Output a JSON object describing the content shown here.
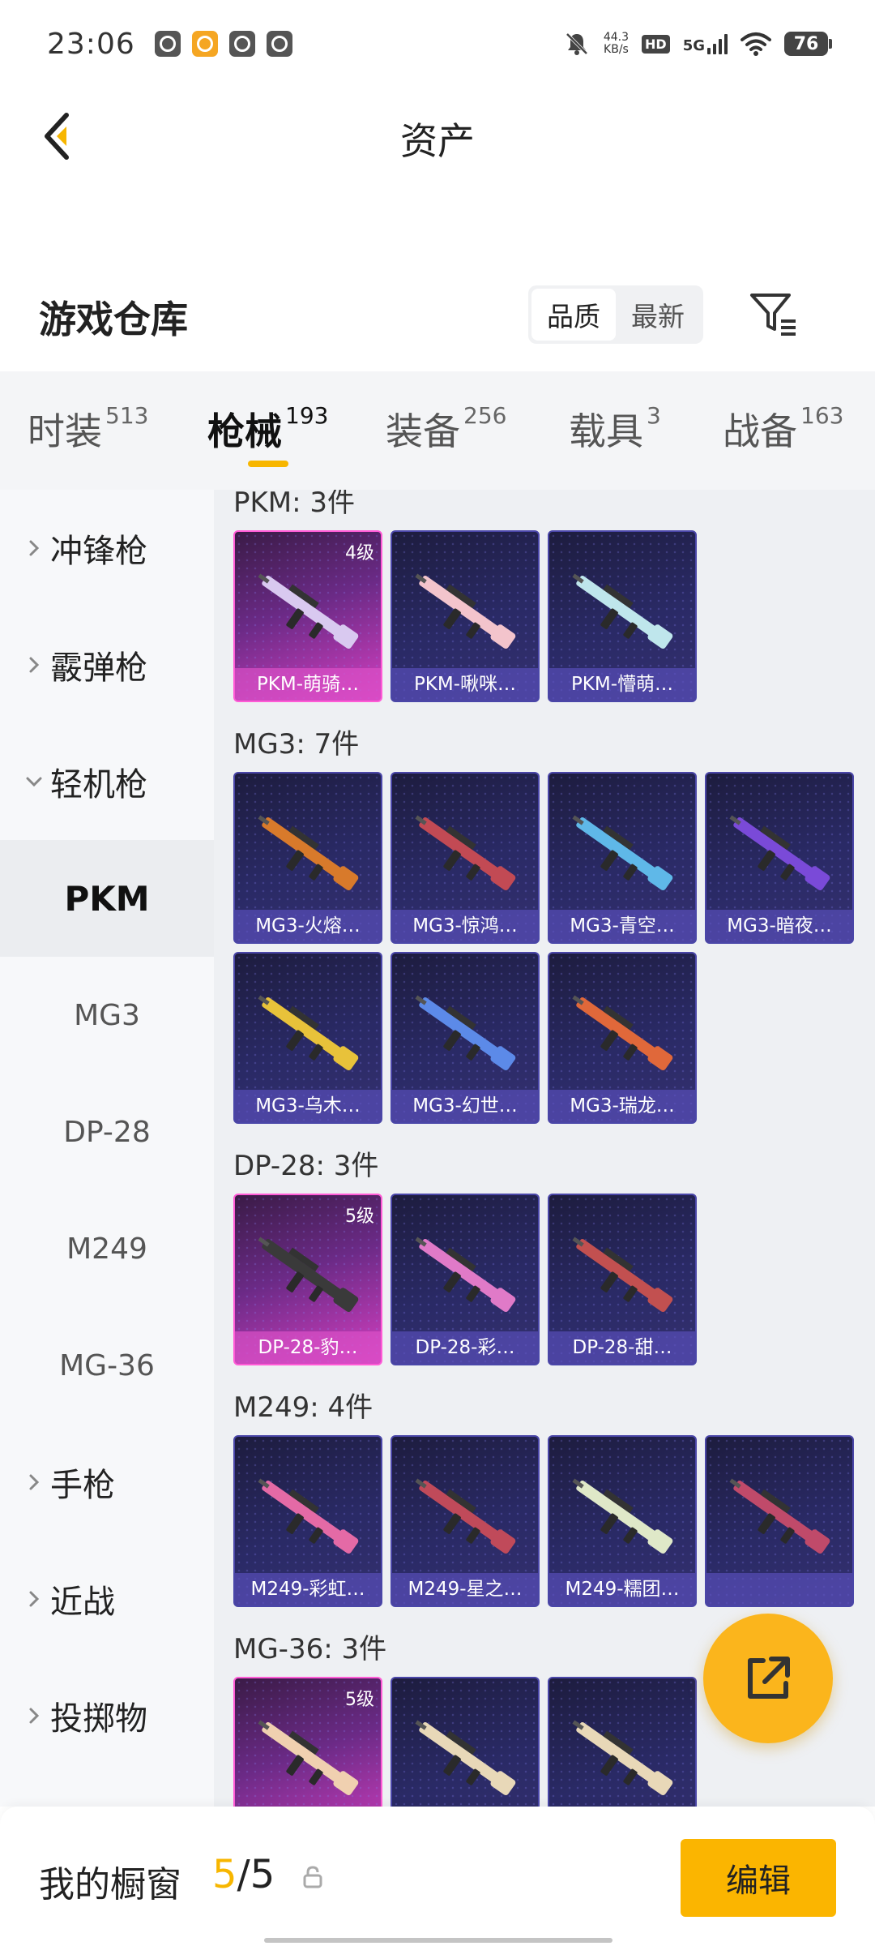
{
  "status_bar": {
    "time": "23:06",
    "net_speed_value": "44.3",
    "net_speed_unit": "KB/s",
    "hd_label": "HD",
    "network_label": "5G",
    "battery_level": "76"
  },
  "header": {
    "title": "资产"
  },
  "warehouse": {
    "title": "游戏仓库",
    "sort_options": [
      "品质",
      "最新"
    ],
    "sort_active": "品质"
  },
  "tabs": [
    {
      "label": "时装",
      "count": "513"
    },
    {
      "label": "枪械",
      "count": "193",
      "active": true
    },
    {
      "label": "装备",
      "count": "256"
    },
    {
      "label": "载具",
      "count": "3"
    },
    {
      "label": "战备",
      "count": "163"
    }
  ],
  "sidebar": {
    "categories": [
      {
        "label": "冲锋枪",
        "expanded": false
      },
      {
        "label": "霰弹枪",
        "expanded": false
      },
      {
        "label": "轻机枪",
        "expanded": true
      },
      {
        "label": "手枪",
        "expanded": false
      },
      {
        "label": "近战",
        "expanded": false
      },
      {
        "label": "投掷物",
        "expanded": false
      }
    ],
    "subitems": [
      {
        "label": "PKM",
        "active": true
      },
      {
        "label": "MG3"
      },
      {
        "label": "DP-28"
      },
      {
        "label": "M249"
      },
      {
        "label": "MG-36"
      }
    ]
  },
  "groups": [
    {
      "title": "PKM: 3件",
      "items": [
        {
          "name": "PKM-萌骑…",
          "level": "4级",
          "rarity": "gold",
          "color": "#d9c9f0"
        },
        {
          "name": "PKM-啾咪…",
          "level": "",
          "rarity": "purple",
          "color": "#f3c4cc"
        },
        {
          "name": "PKM-懵萌…",
          "level": "",
          "rarity": "purple",
          "color": "#bfe6ec"
        }
      ]
    },
    {
      "title": "MG3: 7件",
      "items": [
        {
          "name": "MG3-火熔…",
          "level": "",
          "rarity": "purple",
          "color": "#d87a2b"
        },
        {
          "name": "MG3-惊鸿…",
          "level": "",
          "rarity": "purple",
          "color": "#c24a54"
        },
        {
          "name": "MG3-青空…",
          "level": "",
          "rarity": "purple",
          "color": "#5fb8e8"
        },
        {
          "name": "MG3-暗夜…",
          "level": "",
          "rarity": "purple",
          "color": "#7a4ad8"
        },
        {
          "name": "MG3-乌木…",
          "level": "",
          "rarity": "purple",
          "color": "#e8c23a"
        },
        {
          "name": "MG3-幻世…",
          "level": "",
          "rarity": "purple",
          "color": "#5c8ae8"
        },
        {
          "name": "MG3-瑞龙…",
          "level": "",
          "rarity": "purple",
          "color": "#e0683a"
        }
      ]
    },
    {
      "title": "DP-28: 3件",
      "items": [
        {
          "name": "DP-28-豹…",
          "level": "5级",
          "rarity": "gold",
          "color": "#3a3a3a"
        },
        {
          "name": "DP-28-彩…",
          "level": "",
          "rarity": "purple",
          "color": "#e07ac8"
        },
        {
          "name": "DP-28-甜…",
          "level": "",
          "rarity": "purple",
          "color": "#c25050"
        }
      ]
    },
    {
      "title": "M249: 4件",
      "items": [
        {
          "name": "M249-彩虹…",
          "level": "",
          "rarity": "purple",
          "color": "#e46aa6"
        },
        {
          "name": "M249-星之…",
          "level": "",
          "rarity": "purple",
          "color": "#c04a5a"
        },
        {
          "name": "M249-糯团…",
          "level": "",
          "rarity": "purple",
          "color": "#dfe8c8"
        },
        {
          "name": "",
          "level": "",
          "rarity": "purple",
          "color": "#c04a6a"
        }
      ]
    },
    {
      "title": "MG-36: 3件",
      "items": [
        {
          "name": "",
          "level": "5级",
          "rarity": "gold",
          "color": "#f0d0b0"
        },
        {
          "name": "",
          "level": "",
          "rarity": "purple",
          "color": "#e8d8b8"
        },
        {
          "name": "",
          "level": "",
          "rarity": "purple",
          "color": "#e8d8b8"
        }
      ]
    }
  ],
  "showcase": {
    "label": "我的橱窗",
    "current": "5",
    "separator": "/",
    "max": "5",
    "edit_label": "编辑"
  },
  "colors": {
    "accent": "#f7b600",
    "card_border": "#4a46a8",
    "gold_border": "#ff5bd6"
  }
}
